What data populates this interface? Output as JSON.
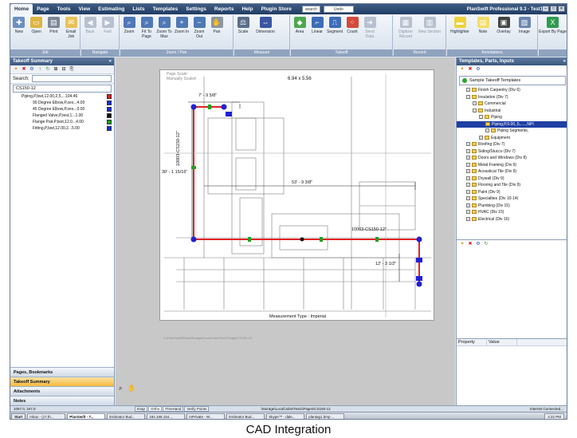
{
  "app": {
    "title": "PlanSwift Professional 9.3 - Test1",
    "quick_search": "search",
    "quick_undo": "Undo"
  },
  "menu": [
    "Home",
    "Page",
    "Tools",
    "View",
    "Estimating",
    "Lists",
    "Templates",
    "Settings",
    "Reports",
    "Help",
    "Plugin Store"
  ],
  "ribbon": {
    "groups": [
      {
        "name": "Job",
        "buttons": [
          "New",
          "Open",
          "Print",
          "Email Job"
        ]
      },
      {
        "name": "Navigate",
        "buttons": [
          "Back",
          "Fwd"
        ]
      },
      {
        "name": "Zoom / Pan",
        "buttons": [
          "Zoom",
          "Fit To Page",
          "Zoom To Max",
          "Zoom In",
          "Zoom Out",
          "Pan"
        ]
      },
      {
        "name": "Measure",
        "buttons": [
          "Scale",
          "Dimension"
        ]
      },
      {
        "name": "Takeoff",
        "buttons": [
          "Area",
          "Linear",
          "Segment",
          "Count",
          "Send Data"
        ]
      },
      {
        "name": "Record",
        "buttons": [
          "Digitizer Record",
          "New Section"
        ]
      },
      {
        "name": "Annotations",
        "buttons": [
          "Highlighter",
          "Note",
          "Overlay",
          "Image"
        ]
      },
      {
        "name": "",
        "buttons": [
          "Export By Page"
        ]
      }
    ]
  },
  "left": {
    "title": "Takeoff Summary",
    "search_label": "Search:",
    "file": "CS150-12",
    "items": [
      {
        "label": "Piping,P,bwt,12.00,2,5,...104.46",
        "color": "#e01818"
      },
      {
        "label": "90 Degree Elbow,P,zes...4.00",
        "color": "#1c2bd6"
      },
      {
        "label": "45 Degree Elbow,P,zes...0.00",
        "color": "#1c2bd6"
      },
      {
        "label": "Flanged Valve,P,test,1...1.00",
        "color": "#111111"
      },
      {
        "label": "Flange Pair,P,test,12.0...4.00",
        "color": "#18a018"
      },
      {
        "label": "Fitting,P,bwt,12.00,2...5.00",
        "color": "#1c2bd6"
      }
    ],
    "tabs": [
      "Pages, Bookmarks",
      "Takeoff Summary",
      "Attachments",
      "Notes"
    ]
  },
  "canvas": {
    "page_scale": "Page Scale:",
    "page_scale_value": "Manually Scaled",
    "sheet_size": "6.94 x 5.56",
    "dims": [
      "7' - 9 5/8\"",
      "10003-CS150-12\"",
      "30' - 1 15/16\"",
      "53' - 9 3/8\"",
      "10003-CS150-12\"",
      "12' - 3 1/2\""
    ],
    "measurement_type": "Measurement Type : Imperial",
    "footer_path": "C:\\PlanSwift9\\Data\\Storage\\Local\\Jobs\\Test1\\Pages\\CS150-12"
  },
  "right": {
    "title": "Templates, Parts, Inputs",
    "selector": "Sample Takeoff Templates",
    "tree": [
      {
        "label": "Finish Carpentry (Div 6)",
        "indent": 1,
        "exp": "+"
      },
      {
        "label": "Insulation (Div 7)",
        "indent": 1,
        "exp": "-"
      },
      {
        "label": "Commercial",
        "indent": 2,
        "exp": "+"
      },
      {
        "label": "Industrial",
        "indent": 2,
        "exp": "-"
      },
      {
        "label": "Piping",
        "indent": 3,
        "exp": "-"
      },
      {
        "label": "Piping,P,0.00,,5,.....,NPI",
        "indent": 4,
        "exp": "",
        "sel": true
      },
      {
        "label": "Piping Segments,",
        "indent": 4,
        "exp": "+"
      },
      {
        "label": "Equipment",
        "indent": 3,
        "exp": "+"
      },
      {
        "label": "Roofing (Div 7)",
        "indent": 1,
        "exp": "+"
      },
      {
        "label": "Siding/Stucco (Div 7)",
        "indent": 1,
        "exp": "+"
      },
      {
        "label": "Doors and Windows (Div 8)",
        "indent": 1,
        "exp": "+"
      },
      {
        "label": "Metal Framing (Div 9)",
        "indent": 1,
        "exp": "+"
      },
      {
        "label": "Acoustical Tile (Div 9)",
        "indent": 1,
        "exp": "+"
      },
      {
        "label": "Drywall (Div 9)",
        "indent": 1,
        "exp": "+"
      },
      {
        "label": "Flooring and Tile (Div 9)",
        "indent": 1,
        "exp": "+"
      },
      {
        "label": "Paint (Div 9)",
        "indent": 1,
        "exp": "+"
      },
      {
        "label": "Specialties (Div 10-14)",
        "indent": 1,
        "exp": "+"
      },
      {
        "label": "Plumbing (Div 15)",
        "indent": 1,
        "exp": "+"
      },
      {
        "label": "HVAC (Div 15)",
        "indent": 1,
        "exp": "+"
      },
      {
        "label": "Electrical (Div 16)",
        "indent": 1,
        "exp": "+"
      }
    ],
    "prop_headers": [
      "Property",
      "Value"
    ]
  },
  "status": {
    "coords": "1067.0, 347.0",
    "toggles": [
      "Snap",
      "Ortho",
      "FreeHand",
      "Verify Points"
    ],
    "path": "\\Storage\\Local\\Jobs\\Test1\\Pages\\CS150-12",
    "net": "Internet Connected..."
  },
  "taskbar": {
    "start": "Start",
    "items": [
      "Inbox - (17,th...",
      "PlanSwift - T...",
      "Estimator Bud...",
      "184.168.154....",
      "InPrivate - W...",
      "Estimator Bud...",
      "Skype™ - dale...",
      "plantag1.bmp ..."
    ],
    "clock": "4:22 PM"
  },
  "caption": "CAD Integration"
}
